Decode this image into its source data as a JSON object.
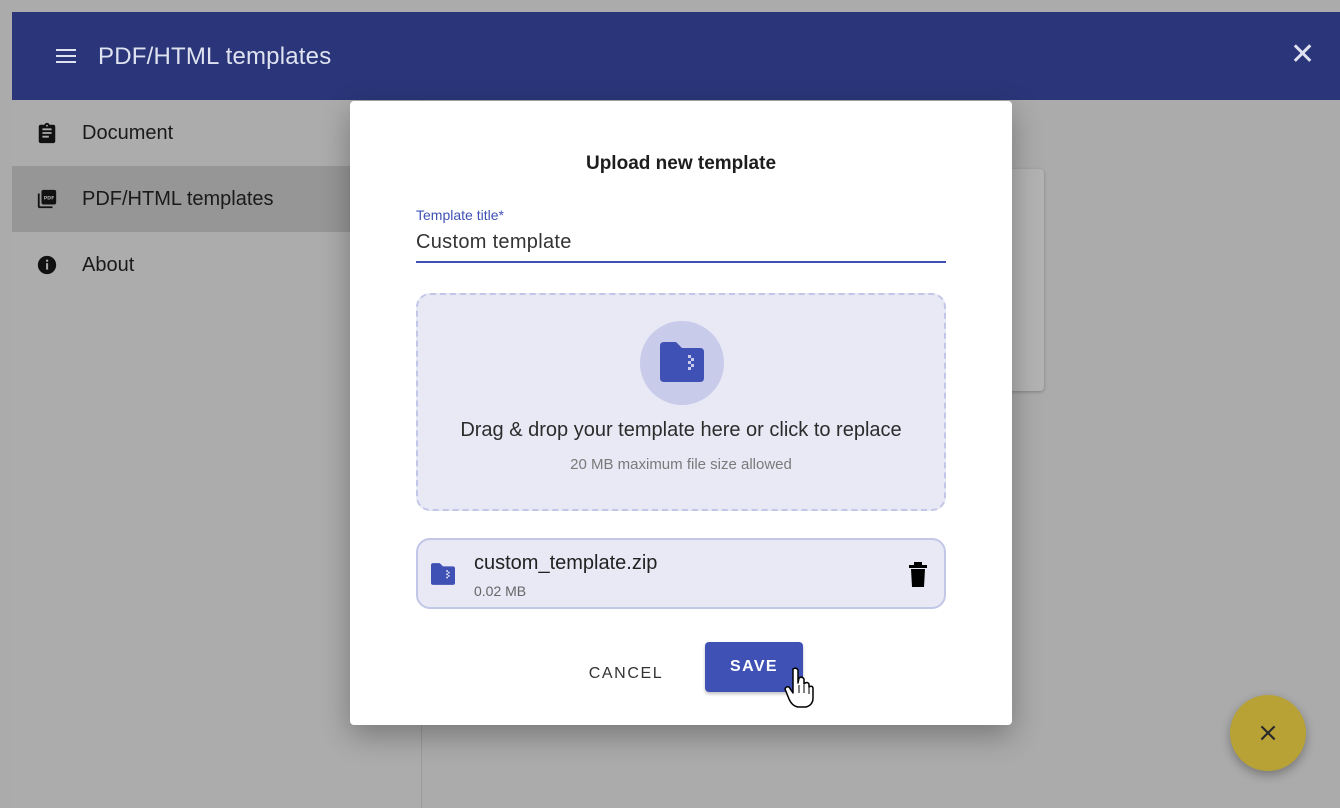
{
  "app": {
    "title": "PDF/HTML templates",
    "close_icon": "close-icon",
    "menu_icon": "menu-icon"
  },
  "sidebar": {
    "items": [
      {
        "label": "Document",
        "icon": "clipboard-icon",
        "active": false
      },
      {
        "label": "PDF/HTML templates",
        "icon": "pdf-icon",
        "active": true
      },
      {
        "label": "About",
        "icon": "info-icon",
        "active": false
      }
    ]
  },
  "dialog": {
    "title": "Upload new template",
    "field_label": "Template title*",
    "field_value": "Custom template",
    "dropzone": {
      "text": "Drag & drop your template here or click to replace",
      "subtext": "20 MB maximum file size allowed",
      "icon": "zip-folder-icon"
    },
    "file": {
      "name": "custom_template.zip",
      "size": "0.02 MB",
      "icon": "zip-folder-icon",
      "delete_icon": "trash-icon"
    },
    "cancel_label": "CANCEL",
    "save_label": "SAVE"
  },
  "fab": {
    "icon": "close-icon",
    "symbol": "×"
  },
  "colors": {
    "app_bar": "#2a3679",
    "primary": "#3f51b5",
    "dropzone_bg": "#e8e9f5",
    "fab": "#b8a236"
  }
}
